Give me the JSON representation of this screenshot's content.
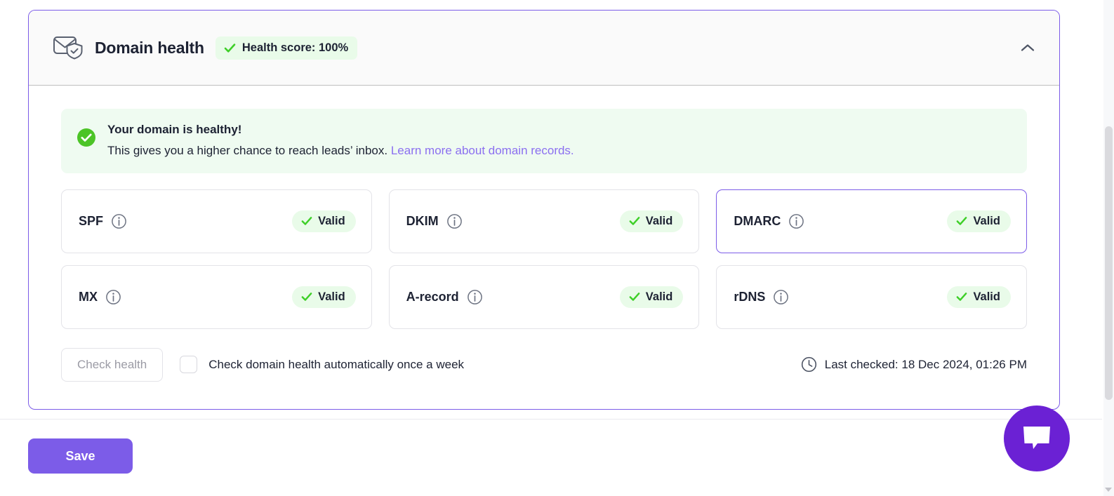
{
  "panel": {
    "title": "Domain health",
    "icon": "envelope-shield-icon",
    "health_badge": {
      "label": "Health score: 100%",
      "icon": "check-icon",
      "bg_color": "#e9fbe9",
      "check_color": "#3ecf28"
    },
    "collapse_icon": "chevron-up-icon",
    "border_color": "#7c5ce8"
  },
  "alert": {
    "icon": "check-circle-filled-icon",
    "icon_color": "#4cc427",
    "bg_color": "#effbf1",
    "title": "Your domain is healthy!",
    "text": "This gives you a higher chance to reach leads’ inbox.",
    "link_text": "Learn more about domain records.",
    "link_color": "#8b6ff0"
  },
  "records": [
    {
      "name": "SPF",
      "info_icon": "info-icon",
      "status": "Valid",
      "status_icon": "check-icon",
      "focused": false
    },
    {
      "name": "DKIM",
      "info_icon": "info-icon",
      "status": "Valid",
      "status_icon": "check-icon",
      "focused": false
    },
    {
      "name": "DMARC",
      "info_icon": "info-icon",
      "status": "Valid",
      "status_icon": "check-icon",
      "focused": true
    },
    {
      "name": "MX",
      "info_icon": "info-icon",
      "status": "Valid",
      "status_icon": "check-icon",
      "focused": false
    },
    {
      "name": "A-record",
      "info_icon": "info-icon",
      "status": "Valid",
      "status_icon": "check-icon",
      "focused": false
    },
    {
      "name": "rDNS",
      "info_icon": "info-icon",
      "status": "Valid",
      "status_icon": "check-icon",
      "focused": false
    }
  ],
  "controls": {
    "check_health_label": "Check health",
    "check_health_disabled": true,
    "auto_check_label": "Check domain health automatically once a week",
    "auto_check_checked": false,
    "last_checked_icon": "clock-icon",
    "last_checked_label": "Last checked: 18 Dec 2024, 01:26 PM"
  },
  "footer": {
    "save_label": "Save",
    "save_color": "#7c5ce8"
  },
  "chat": {
    "icon": "chat-bubble-icon",
    "color": "#6b21d4"
  }
}
